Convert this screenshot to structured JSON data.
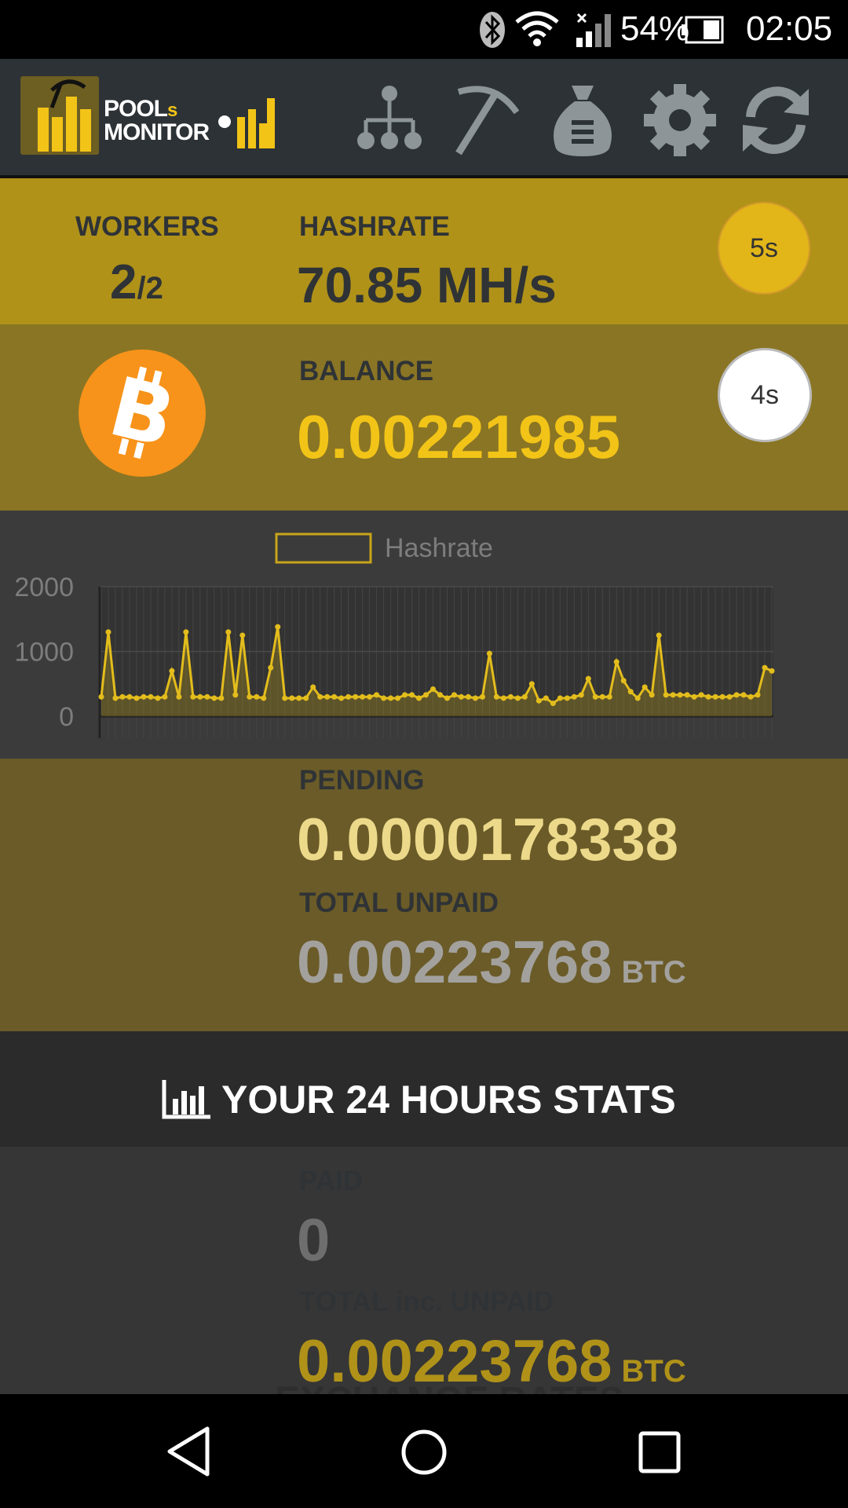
{
  "status_bar": {
    "battery": "54%",
    "time": "02:05"
  },
  "app": {
    "logo_line1": "POOL",
    "logo_s": "s",
    "logo_line2": "MONITOR"
  },
  "workers": {
    "label": "WORKERS",
    "value": "2",
    "total": "/2"
  },
  "hashrate": {
    "label": "HASHRATE",
    "value": "70.85 MH/s",
    "timer": "5s"
  },
  "balance": {
    "label": "BALANCE",
    "value": "0.00221985",
    "timer": "4s"
  },
  "chart_data": {
    "type": "line",
    "legend": [
      "Hashrate"
    ],
    "yticks": [
      "2000",
      "1000",
      "0"
    ],
    "ylim": [
      0,
      2000
    ],
    "grid": true,
    "series": [
      {
        "name": "Hashrate",
        "values": [
          300,
          1300,
          280,
          300,
          300,
          280,
          300,
          300,
          280,
          300,
          700,
          300,
          1300,
          300,
          300,
          300,
          280,
          280,
          1300,
          330,
          1250,
          300,
          300,
          280,
          750,
          1380,
          280,
          280,
          280,
          280,
          450,
          300,
          300,
          300,
          280,
          300,
          300,
          300,
          300,
          330,
          280,
          280,
          280,
          330,
          330,
          280,
          330,
          420,
          330,
          280,
          330,
          300,
          300,
          280,
          300,
          970,
          300,
          280,
          300,
          280,
          300,
          500,
          240,
          280,
          200,
          280,
          280,
          300,
          330,
          580,
          300,
          300,
          300,
          840,
          550,
          380,
          280,
          450,
          330,
          1250,
          330,
          330,
          330,
          330,
          300,
          330,
          300,
          300,
          300,
          300,
          330,
          330,
          300,
          330,
          750,
          700
        ]
      }
    ]
  },
  "pending": {
    "label": "PENDING",
    "value": "0.0000178338"
  },
  "total_unpaid": {
    "label": "TOTAL UNPAID",
    "value": "0.00223768",
    "unit": "BTC"
  },
  "stats": {
    "title": "YOUR 24 HOURS STATS"
  },
  "paid": {
    "label": "PAID",
    "value": "0"
  },
  "total_inc_unpaid": {
    "label": "TOTAL inc. UNPAID",
    "value": "0.00223768",
    "unit": "BTC"
  },
  "exchange_peek": "EXCHANGE RATES",
  "icons": [
    "workers-tree-icon",
    "pickaxe-icon",
    "money-bag-icon",
    "settings-gear-icon",
    "refresh-icon",
    "bitcoin-icon",
    "bar-chart-icon"
  ]
}
